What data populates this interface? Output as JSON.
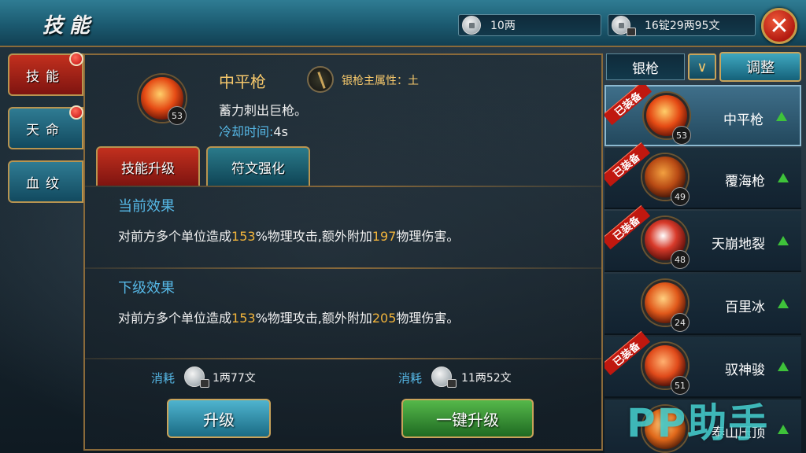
{
  "header": {
    "title": "技能",
    "currency_silver": "10两",
    "currency_bound": "16锭29两95文",
    "close_icon": "close-icon"
  },
  "side_tabs": [
    {
      "label": "技能",
      "active": true,
      "badge": true
    },
    {
      "label": "天命",
      "active": false,
      "badge": true
    },
    {
      "label": "血纹",
      "active": false,
      "badge": false
    }
  ],
  "skill": {
    "name": "中平枪",
    "level": "53",
    "attribute": "银枪主属性：土",
    "description": "蓄力刺出巨枪。",
    "cooldown_label": "冷却时间:",
    "cooldown_value": "4s"
  },
  "tabs": [
    {
      "label": "技能升级",
      "active": true
    },
    {
      "label": "符文强化",
      "active": false
    }
  ],
  "current_effect": {
    "title": "当前效果",
    "text_pre": "对前方多个单位造成",
    "value1": "153",
    "text_mid": "%物理攻击,额外附加",
    "value2": "197",
    "text_post": "物理伤害。"
  },
  "next_effect": {
    "title": "下级效果",
    "text_pre": "对前方多个单位造成",
    "value1": "153",
    "text_mid": "%物理攻击,额外附加",
    "value2": "205",
    "text_post": "物理伤害。"
  },
  "costs": {
    "label": "消耗",
    "upgrade_cost": "1两77文",
    "oneclick_cost": "11两52文"
  },
  "buttons": {
    "upgrade": "升级",
    "oneclick_upgrade": "一键升级",
    "adjust": "调整"
  },
  "weapon_filter": {
    "selected": "银枪"
  },
  "equipped_tag": "已装备",
  "skill_list": [
    {
      "name": "中平枪",
      "level": "53",
      "equipped": true,
      "selected": true
    },
    {
      "name": "覆海枪",
      "level": "49",
      "equipped": true,
      "selected": false
    },
    {
      "name": "天崩地裂",
      "level": "48",
      "equipped": true,
      "selected": false
    },
    {
      "name": "百里冰",
      "level": "24",
      "equipped": false,
      "selected": false
    },
    {
      "name": "驭神骏",
      "level": "51",
      "equipped": true,
      "selected": false
    },
    {
      "name": "泰山压顶",
      "level": "",
      "equipped": false,
      "selected": false
    }
  ],
  "watermark": "PP助手",
  "colors": {
    "highlight": "#f2b43b",
    "label_blue": "#56b8e6",
    "active_red": "#c2301e",
    "teal": "#2f7c93"
  }
}
